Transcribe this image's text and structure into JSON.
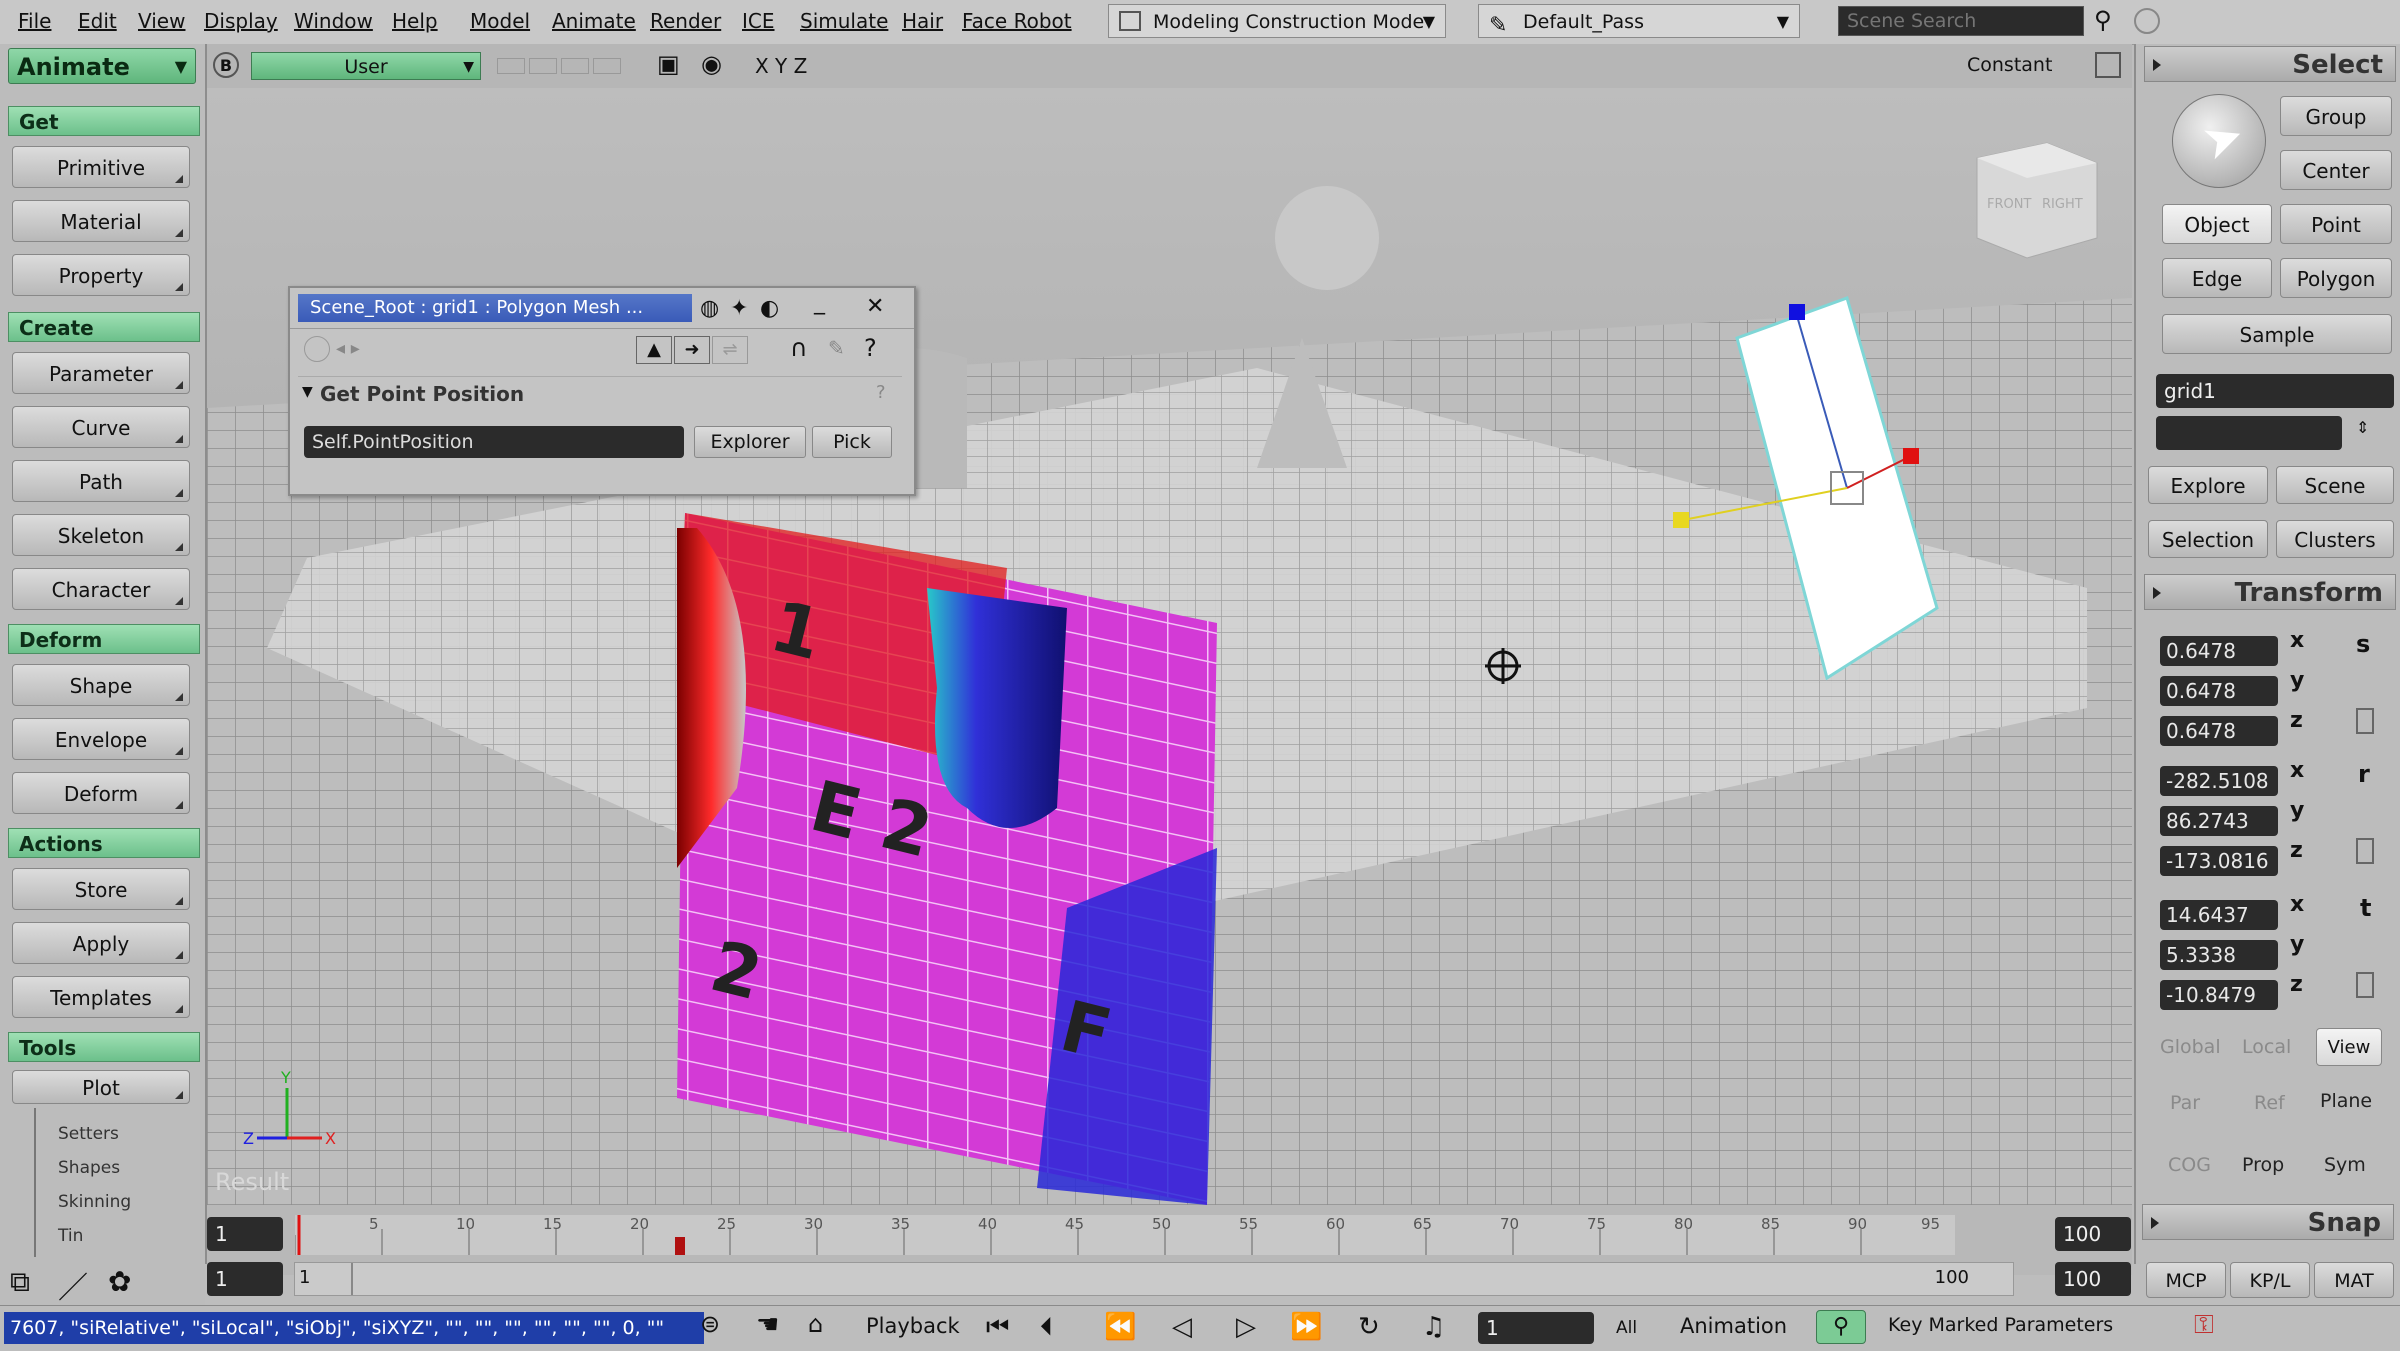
{
  "menu": {
    "items": [
      "File",
      "Edit",
      "View",
      "Display",
      "Window",
      "Help",
      "Model",
      "Animate",
      "Render",
      "ICE",
      "Simulate",
      "Hair",
      "Face Robot"
    ],
    "construction_mode": "Modeling Construction Mode",
    "pass": "Default_Pass",
    "search_placeholder": "Scene Search"
  },
  "left_panel": {
    "mode": "Animate",
    "sections": {
      "get": "Get",
      "create": "Create",
      "deform": "Deform",
      "actions": "Actions",
      "tools": "Tools"
    },
    "get_buttons": [
      "Primitive",
      "Material",
      "Property"
    ],
    "create_buttons": [
      "Parameter",
      "Curve",
      "Path",
      "Skeleton",
      "Character"
    ],
    "deform_buttons": [
      "Shape",
      "Envelope",
      "Deform"
    ],
    "actions_buttons": [
      "Store",
      "Apply",
      "Templates"
    ],
    "tools_button": "Plot",
    "tools_sublist": [
      "Setters",
      "Shapes",
      "Skinning",
      "Tin"
    ]
  },
  "viewport": {
    "camera": "User",
    "axes_label": "X Y Z",
    "shading": "Constant",
    "view_label": "Result",
    "letter": "B",
    "cube_faces": [
      "RIGHT",
      "FRONT"
    ]
  },
  "property_editor": {
    "title": "Scene_Root : grid1 : Polygon Mesh ...",
    "section": "Get Point Position",
    "field_value": "Self.PointPosition",
    "explorer_button": "Explorer",
    "pick_button": "Pick",
    "help_icon": "?"
  },
  "right_panel": {
    "select_header": "Select",
    "group": "Group",
    "center": "Center",
    "object": "Object",
    "point": "Point",
    "edge": "Edge",
    "polygon": "Polygon",
    "sample": "Sample",
    "selection_name": "grid1",
    "explore": "Explore",
    "scene": "Scene",
    "selection": "Selection",
    "clusters": "Clusters",
    "transform_header": "Transform",
    "scale": {
      "x": "0.6478",
      "y": "0.6478",
      "z": "0.6478",
      "label": "s"
    },
    "rotate": {
      "x": "-282.5108",
      "y": "86.2743",
      "z": "-173.0816",
      "label": "r"
    },
    "translate": {
      "x": "14.6437",
      "y": "5.3338",
      "z": "-10.8479",
      "label": "t"
    },
    "axis_letters": [
      "x",
      "y",
      "z"
    ],
    "ref_modes": [
      "Global",
      "Local",
      "View"
    ],
    "ref_modes2": [
      "Par",
      "Ref",
      "Plane"
    ],
    "cog": "COG",
    "prop": "Prop",
    "sym": "Sym",
    "snap_header": "Snap",
    "snap_buttons": [
      "MCP",
      "KP/L",
      "MAT"
    ]
  },
  "timeline": {
    "start": "1",
    "end": "100",
    "ticks": [
      "5",
      "10",
      "15",
      "20",
      "25",
      "30",
      "35",
      "40",
      "45",
      "50",
      "55",
      "60",
      "65",
      "70",
      "75",
      "80",
      "85",
      "90",
      "95"
    ],
    "range_start": "1",
    "range_start2": "1",
    "range_end": "100",
    "range_end2": "100"
  },
  "status": {
    "script_line": "7607, \"siRelative\", \"siLocal\", \"siObj\", \"siXYZ\", \"\", \"\", \"\", \"\", \"\", \"\", 0, \"\"",
    "playback": "Playback",
    "frame": "1",
    "all": "All",
    "animation": "Animation",
    "key_marked": "Key Marked Parameters"
  },
  "colors": {
    "accent_green": "#7ccb95",
    "dark_field": "#2b2b2b",
    "select_blue": "#3a5bb8"
  }
}
